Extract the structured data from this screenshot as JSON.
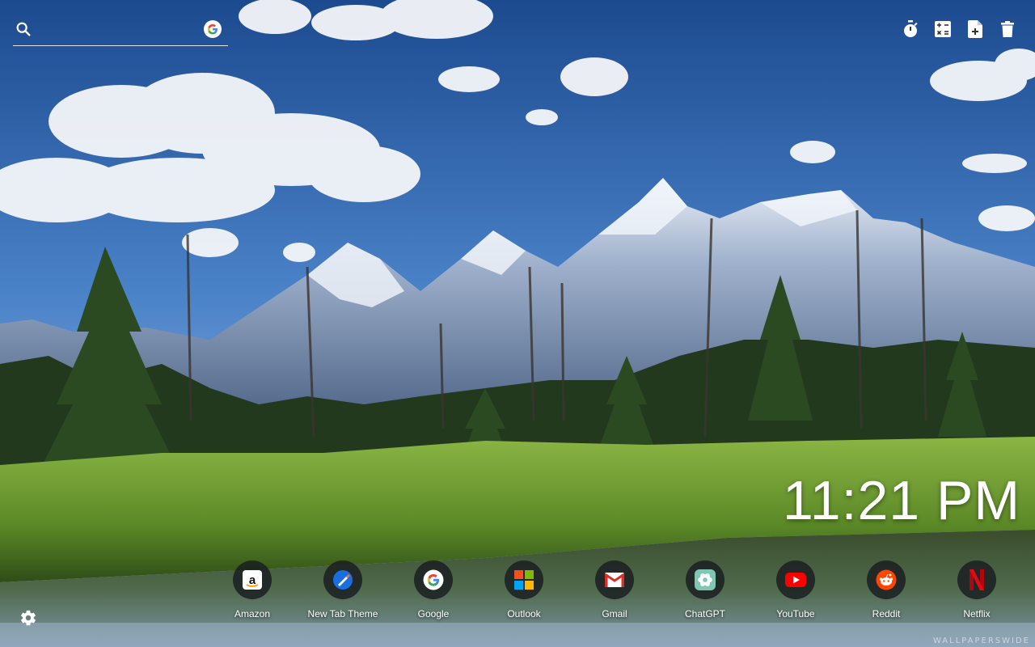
{
  "search": {
    "placeholder": "",
    "engine_icon": "google-icon"
  },
  "toolbar": {
    "items": [
      {
        "name": "timer",
        "icon": "stopwatch-icon"
      },
      {
        "name": "calculator",
        "icon": "calculator-icon"
      },
      {
        "name": "notes",
        "icon": "note-add-icon"
      },
      {
        "name": "delete",
        "icon": "trash-icon"
      }
    ]
  },
  "clock": {
    "time": "11:21 PM"
  },
  "shortcuts": [
    {
      "label": "Amazon",
      "icon": "amazon-icon"
    },
    {
      "label": "New Tab Theme",
      "icon": "new-tab-theme-icon"
    },
    {
      "label": "Google",
      "icon": "google-icon"
    },
    {
      "label": "Outlook",
      "icon": "microsoft-icon"
    },
    {
      "label": "Gmail",
      "icon": "gmail-icon"
    },
    {
      "label": "ChatGPT",
      "icon": "chatgpt-icon"
    },
    {
      "label": "YouTube",
      "icon": "youtube-icon"
    },
    {
      "label": "Reddit",
      "icon": "reddit-icon"
    },
    {
      "label": "Netflix",
      "icon": "netflix-icon"
    }
  ],
  "settings": {
    "icon": "gear-icon"
  },
  "watermark": {
    "text": "WALLPAPERSWIDE"
  },
  "colors": {
    "text": "#ffffff",
    "sky_top": "#1f4f95",
    "sky_bottom": "#9fc4ea",
    "grass": "#6f9a2e",
    "water": "#2d3f2a"
  }
}
